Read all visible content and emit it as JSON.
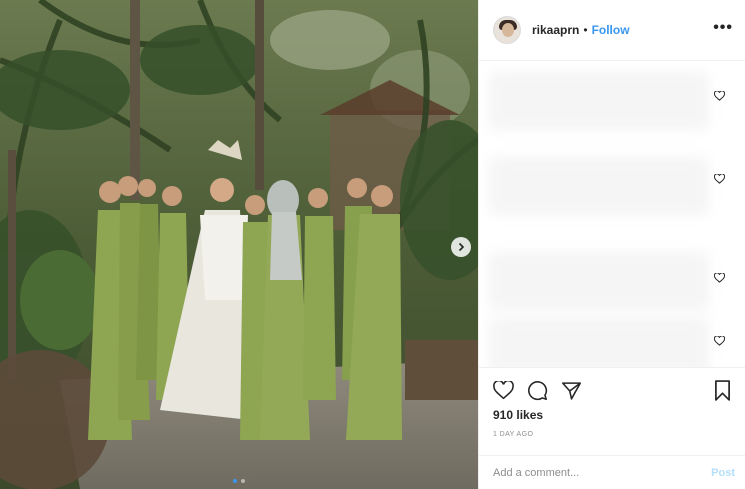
{
  "post": {
    "username": "rikaaprn",
    "separator": "•",
    "follow_label": "Follow",
    "more_label": "•••",
    "likes": "910 likes",
    "timestamp": "1 DAY AGO",
    "comment_placeholder": "Add a comment...",
    "post_label": "Post"
  },
  "photo": {
    "description_icon": "photo",
    "next_icon": "chevron-right-icon",
    "carousel_pages": 2,
    "carousel_active": 0
  },
  "colors": {
    "accent": "#3897f0",
    "post_disabled": "#b2dffc",
    "text": "#262626",
    "muted": "#8e8e8e",
    "dress": "#8ea552",
    "foliage": "#3f5230"
  }
}
